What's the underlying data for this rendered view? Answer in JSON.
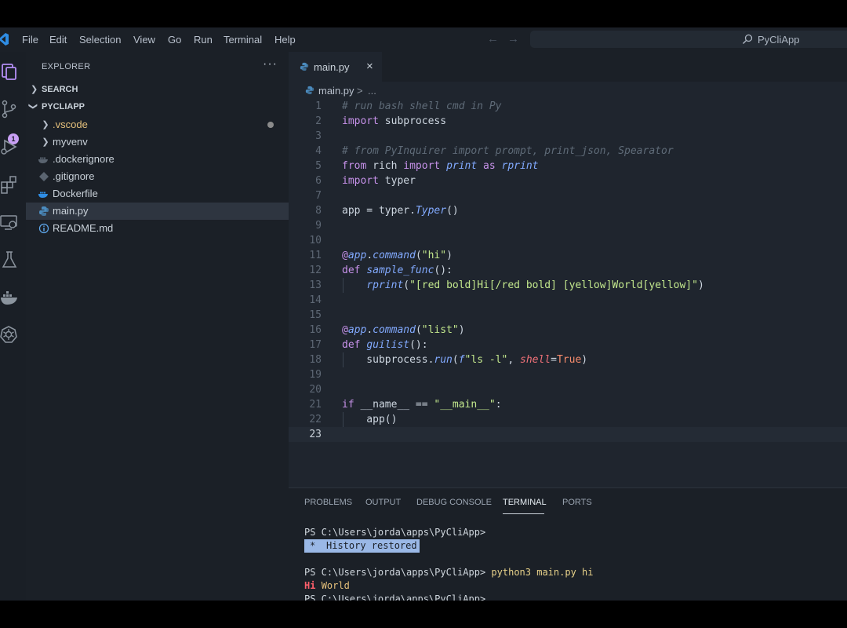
{
  "menu": [
    "File",
    "Edit",
    "Selection",
    "View",
    "Go",
    "Run",
    "Terminal",
    "Help"
  ],
  "command_center": {
    "label": "PyCliApp"
  },
  "activity_bar": {
    "icons": [
      "explorer-icon",
      "source-control-icon",
      "run-debug-icon",
      "extensions-icon",
      "remote-explorer-icon",
      "testing-icon",
      "docker-icon",
      "kubernetes-icon"
    ],
    "scm_badge": "1"
  },
  "sidebar": {
    "title": "EXPLORER",
    "more": "···",
    "search_section": "SEARCH",
    "project_section": "PYCLIAPP",
    "items": [
      {
        "label": ".vscode",
        "type": "folder",
        "color": "#e5c07b"
      },
      {
        "label": "myvenv",
        "type": "folder",
        "color": "#c9d1d9"
      },
      {
        "label": ".dockerignore",
        "type": "docker",
        "color": "#c9d1d9"
      },
      {
        "label": ".gitignore",
        "type": "git",
        "color": "#c9d1d9"
      },
      {
        "label": "Dockerfile",
        "type": "docker",
        "color": "#c9d1d9"
      },
      {
        "label": "main.py",
        "type": "python",
        "color": "#c9d1d9",
        "selected": true
      },
      {
        "label": "README.md",
        "type": "info",
        "color": "#c9d1d9"
      }
    ]
  },
  "editor": {
    "tab": {
      "label": "main.py",
      "close": "×"
    },
    "breadcrumb": {
      "file": "main.py",
      "sep": ">",
      "rest": "..."
    },
    "line_numbers": [
      "1",
      "2",
      "3",
      "4",
      "5",
      "6",
      "7",
      "8",
      "9",
      "10",
      "11",
      "12",
      "13",
      "14",
      "15",
      "16",
      "17",
      "18",
      "19",
      "20",
      "21",
      "22",
      "23"
    ],
    "lines": [
      [
        [
          "cm",
          "# run bash shell cmd in Py"
        ]
      ],
      [
        [
          "kw",
          "import"
        ],
        [
          "pl",
          " subprocess"
        ]
      ],
      [],
      [
        [
          "cm",
          "# from PyInquirer import prompt, print_json, Spearator"
        ]
      ],
      [
        [
          "kw",
          "from"
        ],
        [
          "pl",
          " rich "
        ],
        [
          "kw",
          "import"
        ],
        [
          "pl",
          " "
        ],
        [
          "fn",
          "print"
        ],
        [
          "pl",
          " "
        ],
        [
          "kw",
          "as"
        ],
        [
          "pl",
          " "
        ],
        [
          "fn",
          "rprint"
        ]
      ],
      [
        [
          "kw",
          "import"
        ],
        [
          "pl",
          " typer"
        ]
      ],
      [],
      [
        [
          "pl",
          "app = typer."
        ],
        [
          "fn",
          "Typer"
        ],
        [
          "pl",
          "()"
        ]
      ],
      [],
      [],
      [
        [
          "kw",
          "@"
        ],
        [
          "fn",
          "app"
        ],
        [
          "pl",
          "."
        ],
        [
          "fn",
          "command"
        ],
        [
          "pl",
          "("
        ],
        [
          "st",
          "\"hi\""
        ],
        [
          "pl",
          ")"
        ]
      ],
      [
        [
          "kw",
          "def"
        ],
        [
          "pl",
          " "
        ],
        [
          "fn",
          "sample_func"
        ],
        [
          "pl",
          "():"
        ]
      ],
      [
        [
          "pl",
          "    "
        ],
        [
          "fn",
          "rprint"
        ],
        [
          "pl",
          "("
        ],
        [
          "st",
          "\"[red bold]Hi[/red bold] [yellow]World[yellow]\""
        ],
        [
          "pl",
          ")"
        ]
      ],
      [],
      [],
      [
        [
          "kw",
          "@"
        ],
        [
          "fn",
          "app"
        ],
        [
          "pl",
          "."
        ],
        [
          "fn",
          "command"
        ],
        [
          "pl",
          "("
        ],
        [
          "st",
          "\"list\""
        ],
        [
          "pl",
          ")"
        ]
      ],
      [
        [
          "kw",
          "def"
        ],
        [
          "pl",
          " "
        ],
        [
          "fn",
          "guilist"
        ],
        [
          "pl",
          "():"
        ]
      ],
      [
        [
          "pl",
          "    subprocess."
        ],
        [
          "fn",
          "run"
        ],
        [
          "pl",
          "("
        ],
        [
          "fn",
          "f"
        ],
        [
          "st",
          "\"ls -l\""
        ],
        [
          "pl",
          ", "
        ],
        [
          "pa",
          "shell"
        ],
        [
          "pl",
          "="
        ],
        [
          "bi",
          "True"
        ],
        [
          "pl",
          ")"
        ]
      ],
      [],
      [],
      [
        [
          "kw",
          "if"
        ],
        [
          "pl",
          " __name__ == "
        ],
        [
          "st",
          "\"__main__\""
        ],
        [
          "pl",
          ":"
        ]
      ],
      [
        [
          "pl",
          "    app()"
        ]
      ],
      []
    ],
    "active_line": "23"
  },
  "panel": {
    "tabs": [
      "PROBLEMS",
      "OUTPUT",
      "DEBUG CONSOLE",
      "TERMINAL",
      "PORTS"
    ],
    "active_tab": "TERMINAL",
    "terminal": {
      "prompt1": "PS C:\\Users\\jorda\\apps\\PyCliApp>",
      "history_star": "*",
      "history_text": "History restored",
      "prompt2": "PS C:\\Users\\jorda\\apps\\PyCliApp>",
      "command": "python3 main.py hi",
      "out_hi": "Hi",
      "out_world": "World",
      "prompt3": "PS C:\\Users\\jorda\\apps\\PyCliApp>"
    }
  },
  "colors": {
    "keyword": "#c792ea",
    "function": "#82aaff",
    "string": "#c3e88d",
    "comment": "#5f6b78",
    "boolean": "#f78c6c",
    "param": "#f07178",
    "editor_bg": "#1f252e",
    "sidebar_bg": "#1b2027",
    "terminal_highlight": "#9ab8e6"
  }
}
